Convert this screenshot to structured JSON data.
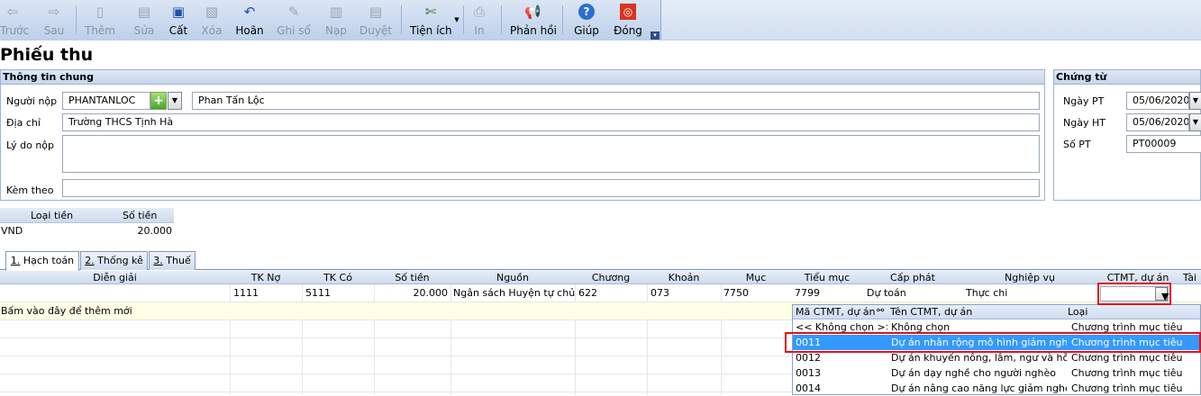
{
  "toolbar": {
    "buttons": [
      {
        "label": "Trước",
        "icon": "arrow-left-icon"
      },
      {
        "label": "Sau",
        "icon": "arrow-right-icon"
      },
      {
        "label": "Thêm",
        "icon": "add-doc-icon"
      },
      {
        "label": "Sửa",
        "icon": "edit-doc-icon"
      },
      {
        "label": "Cất",
        "icon": "save-icon"
      },
      {
        "label": "Xóa",
        "icon": "delete-icon"
      },
      {
        "label": "Hoãn",
        "icon": "undo-icon"
      },
      {
        "label": "Ghi sổ",
        "icon": "pencil-icon"
      },
      {
        "label": "Nạp",
        "icon": "reload-icon"
      },
      {
        "label": "Duyệt",
        "icon": "approve-icon"
      },
      {
        "label": "Tiện ích",
        "icon": "tools-icon"
      },
      {
        "label": "In",
        "icon": "print-icon"
      },
      {
        "label": "Phản hồi",
        "icon": "megaphone-icon"
      },
      {
        "label": "Giúp",
        "icon": "help-icon"
      },
      {
        "label": "Đóng",
        "icon": "close-icon"
      }
    ]
  },
  "page": {
    "title": "Phiếu thu"
  },
  "general": {
    "header": "Thông tin chung",
    "payer_label": "Người nộp",
    "payer_code": "PHANTANLOC",
    "payer_name": "Phan Tấn Lộc",
    "address_label": "Địa chỉ",
    "address": "Trường THCS Tịnh Hà",
    "reason_label": "Lý do nộp",
    "reason": "",
    "attach_label": "Kèm theo",
    "attach": ""
  },
  "voucher": {
    "header": "Chứng từ",
    "date_pt_label": "Ngày PT",
    "date_pt": "05/06/2020",
    "date_ht_label": "Ngày HT",
    "date_ht": "05/06/2020",
    "number_label": "Số PT",
    "number": "PT00009"
  },
  "currency": {
    "col_type": "Loại tiền",
    "col_amount": "Số tiền",
    "type": "VND",
    "amount": "20.000"
  },
  "tabs": [
    {
      "num": "1.",
      "label": " Hạch toán"
    },
    {
      "num": "2.",
      "label": " Thống kê"
    },
    {
      "num": "3.",
      "label": " Thuế"
    }
  ],
  "grid": {
    "columns": [
      "Diễn giải",
      "TK Nợ",
      "TK Có",
      "Số tiền",
      "Nguồn",
      "Chương",
      "Khoản",
      "Mục",
      "Tiểu mục",
      "Cấp phát",
      "Nghiệp vụ",
      "CTMT, dự án",
      "Tài"
    ],
    "row": {
      "tk_no": "1111",
      "tk_co": "5111",
      "amount": "20.000",
      "source": "Ngân sách Huyện tự chủ",
      "chapter": "622",
      "section": "073",
      "item": "7750",
      "subitem": "7799",
      "allocation": "Dự toán",
      "operation": "Thực chi",
      "project": ""
    },
    "new_row_hint": "Bấm vào đây để thêm mới"
  },
  "project_dropdown": {
    "columns": [
      "Mã CTMT, dự án",
      "Tên CTMT, dự án",
      "Loại"
    ],
    "rows": [
      {
        "code": "<< Không chọn >>",
        "name": "Không chọn",
        "type": "Chương trình mục tiêu"
      },
      {
        "code": "0011",
        "name": "Dự án nhân rộng mô hình giảm nghèo",
        "type": "Chương trình mục tiêu"
      },
      {
        "code": "0012",
        "name": "Dự án khuyến nông, lâm, ngư và hỗ tr...",
        "type": "Chương trình mục tiêu"
      },
      {
        "code": "0013",
        "name": "Dự án dạy nghề cho người nghèo",
        "type": "Chương trình mục tiêu"
      },
      {
        "code": "0014",
        "name": "Dự án nâng cao năng lực giảm nghèo",
        "type": "Chương trình mục tiêu"
      }
    ],
    "selected_index": 1
  },
  "colors": {
    "selection": "#3399ff",
    "highlight": "#e0101a",
    "new_row": "#ffffe5"
  }
}
